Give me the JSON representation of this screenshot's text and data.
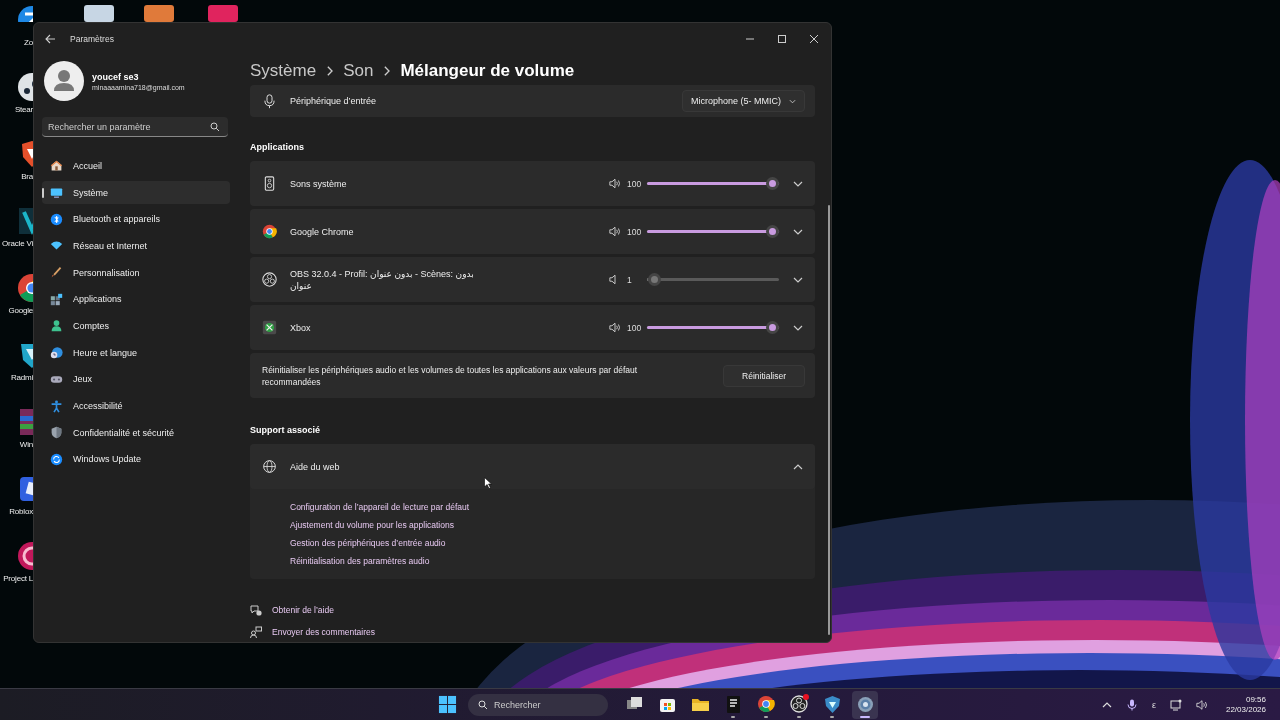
{
  "desktop_icons": [
    {
      "label": "Zo"
    },
    {
      "label": "Stear"
    },
    {
      "label": "Bra"
    },
    {
      "label": "Oracle Vi"
    },
    {
      "label": "Google"
    },
    {
      "label": "Radmi"
    },
    {
      "label": "Win"
    },
    {
      "label": "Roblox"
    },
    {
      "label": "Project L"
    }
  ],
  "window": {
    "title": "Paramètres"
  },
  "account": {
    "name": "youcef se3",
    "email": "minaaaamina718@gmail.com"
  },
  "search": {
    "placeholder": "Rechercher un paramètre"
  },
  "nav": [
    {
      "label": "Accueil",
      "selected": false
    },
    {
      "label": "Système",
      "selected": true
    },
    {
      "label": "Bluetooth et appareils",
      "selected": false
    },
    {
      "label": "Réseau et Internet",
      "selected": false
    },
    {
      "label": "Personnalisation",
      "selected": false
    },
    {
      "label": "Applications",
      "selected": false
    },
    {
      "label": "Comptes",
      "selected": false
    },
    {
      "label": "Heure et langue",
      "selected": false
    },
    {
      "label": "Jeux",
      "selected": false
    },
    {
      "label": "Accessibilité",
      "selected": false
    },
    {
      "label": "Confidentialité et sécurité",
      "selected": false
    },
    {
      "label": "Windows Update",
      "selected": false
    }
  ],
  "breadcrumb": [
    "Système",
    "Son",
    "Mélangeur de volume"
  ],
  "input_device": {
    "label": "Périphérique d’entrée",
    "value": "Microphone (5- MMIC)"
  },
  "applications": {
    "heading": "Applications",
    "apps": [
      {
        "name": "Sons système",
        "reading": "100",
        "level": 1.0
      },
      {
        "name": "Google Chrome",
        "reading": "100",
        "level": 1.0
      },
      {
        "name": "OBS 32.0.4 - Profil: بدون عنوان - Scènes: بدون عنوان",
        "reading": "1",
        "level": 0.01
      },
      {
        "name": "Xbox",
        "reading": "100",
        "level": 1.0
      }
    ]
  },
  "reset": {
    "text": "Réinitialiser les périphériques audio et les volumes de toutes les applications aux valeurs par défaut recommandées",
    "button": "Réinitialiser"
  },
  "support": {
    "heading": "Support associé",
    "title": "Aide du web",
    "expanded": true,
    "links": [
      "Configuration de l’appareil de lecture par défaut",
      "Ajustement du volume pour les applications",
      "Gestion des périphériques d’entrée audio",
      "Réinitialisation des paramètres audio"
    ]
  },
  "footer_links": [
    "Obtenir de l’aide",
    "Envoyer des commentaires"
  ],
  "taskbar": {
    "search_placeholder": "Rechercher",
    "apps": [
      {
        "running": false,
        "selected": false,
        "notification": false
      },
      {
        "running": false,
        "selected": false,
        "notification": false
      },
      {
        "running": false,
        "selected": false,
        "notification": false
      },
      {
        "running": true,
        "selected": false,
        "notification": false
      },
      {
        "running": true,
        "selected": false,
        "notification": false
      },
      {
        "running": true,
        "selected": false,
        "notification": true
      },
      {
        "running": true,
        "selected": false,
        "notification": false
      },
      {
        "running": true,
        "selected": true,
        "notification": false
      }
    ],
    "language": "ε",
    "time": "09:56",
    "date": "22/03/2026"
  }
}
